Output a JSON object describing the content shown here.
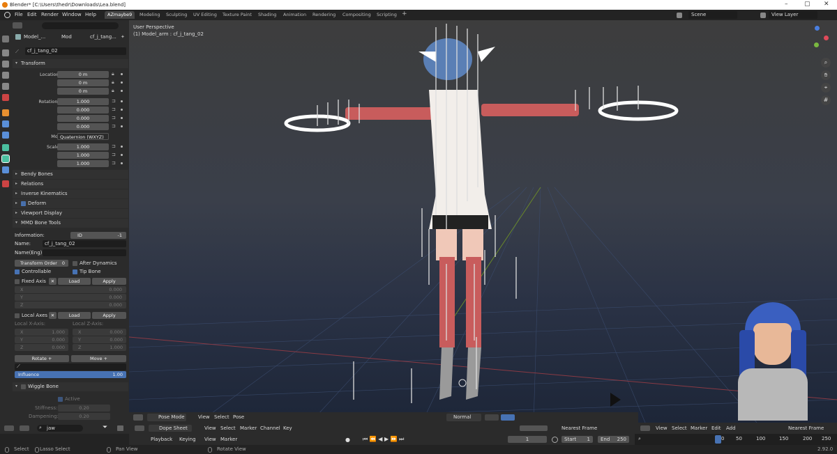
{
  "window": {
    "title": "Blender* [C:\\Users\\thedr\\Downloads\\Lea.blend]",
    "min": "–",
    "max": "▢",
    "close": "✕"
  },
  "menu": [
    "File",
    "Edit",
    "Render",
    "Window",
    "Help"
  ],
  "workspaces": [
    "AZmaybe9",
    "Modeling",
    "Sculpting",
    "UV Editing",
    "Texture Paint",
    "Shading",
    "Animation",
    "Rendering",
    "Compositing",
    "Scripting"
  ],
  "add_tab": "+",
  "scene": {
    "label": "Scene",
    "view_layer": "View Layer"
  },
  "props": {
    "crumbs": [
      "Model_...",
      "Mod",
      "cf_j_tang..."
    ],
    "bone_name": "cf_j_tang_02",
    "transform": {
      "title": "Transform",
      "location": [
        {
          "label": "Location X",
          "val": "0 m"
        },
        {
          "label": "Y",
          "val": "0 m"
        },
        {
          "label": "Z",
          "val": "0 m"
        }
      ],
      "rotation": [
        {
          "label": "Rotation W",
          "val": "1.000"
        },
        {
          "label": "X",
          "val": "0.000"
        },
        {
          "label": "Y",
          "val": "0.000"
        },
        {
          "label": "Z",
          "val": "0.000"
        }
      ],
      "mode_label": "Mode",
      "mode": "Quaternion (WXYZ)",
      "scale": [
        {
          "label": "Scale X",
          "val": "1.000"
        },
        {
          "label": "Y",
          "val": "1.000"
        },
        {
          "label": "Z",
          "val": "1.000"
        }
      ]
    },
    "sections": [
      "Bendy Bones",
      "Relations",
      "Inverse Kinematics",
      "Deform",
      "Viewport Display",
      "MMD Bone Tools"
    ],
    "mmd": {
      "info_label": "Information:",
      "info_id": "ID",
      "info_val": "-1",
      "name_label": "Name:",
      "name": "cf_j_tang_02",
      "name_eng_label": "Name(Eng):",
      "transform_order": "Transform Order",
      "transform_order_val": "0",
      "after_dynamics": "After Dynamics",
      "controllable": "Controllable",
      "tip_bone": "Tip Bone",
      "fixed_axis": "Fixed Axis",
      "load": "Load",
      "apply": "Apply",
      "x": "X",
      "y": "Y",
      "z": "Z",
      "zero": "0.000",
      "one": "1.000",
      "local_axes": "Local Axes",
      "local_x": "Local X-Axis:",
      "local_z": "Local Z-Axis:",
      "rotate": "Rotate +",
      "move": "Move +",
      "influence": "Influence",
      "influence_val": "1.00"
    },
    "wiggle": {
      "title": "Wiggle Bone",
      "active": "Active",
      "stiffness": "Stiffness:",
      "stiffness_val": "0.20",
      "dampening": "Dampening:",
      "dampening_val": "0.20"
    }
  },
  "viewport": {
    "title": "User Perspective",
    "subtitle": "(1) Model_arm : cf_j_tang_02",
    "header": [
      "Pose Mode",
      "View",
      "Select",
      "Pose"
    ],
    "orientation": "Normal"
  },
  "bottom": {
    "search": "jaw",
    "dopesheet": "Dope Sheet",
    "dopesheet_menu": [
      "View",
      "Select",
      "Marker",
      "Channel",
      "Key"
    ],
    "nearest": "Nearest Frame",
    "timeline_menu": [
      "View",
      "Select",
      "Marker",
      "Edit",
      "Add"
    ],
    "nearest2": "Nearest Frame",
    "playback": "Playback",
    "keying": "Keying",
    "view": "View",
    "marker": "Marker",
    "frame": "1",
    "start_label": "Start",
    "start": "1",
    "end_label": "End",
    "end": "250",
    "ruler": [
      "0",
      "50",
      "100",
      "150",
      "200",
      "250"
    ]
  },
  "status": {
    "select": "Select",
    "lasso": "Lasso Select",
    "pan": "Pan View",
    "rotate": "Rotate View",
    "version": "2.92.0"
  }
}
